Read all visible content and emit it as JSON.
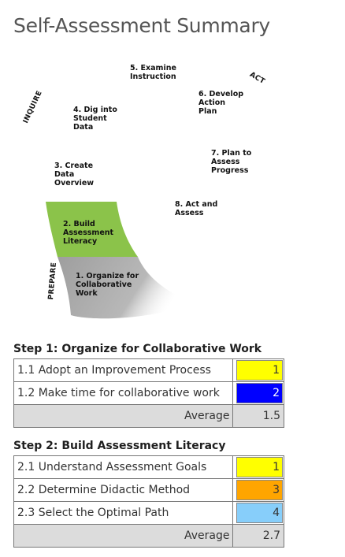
{
  "page": {
    "title": "Self-Assessment Summary"
  },
  "diagram": {
    "phases": {
      "inquire": "INQUIRE",
      "act": "ACT",
      "prepare": "PREPARE"
    },
    "steps": [
      {
        "label": "1. Organize for\nCollaborative\nWork"
      },
      {
        "label": "2. Build\nAssessment\nLiteracy"
      },
      {
        "label": "3. Create\nData\nOverview"
      },
      {
        "label": "4. Dig into\nStudent\nData"
      },
      {
        "label": "5. Examine\nInstruction"
      },
      {
        "label": "6. Develop\nAction\nPlan"
      },
      {
        "label": "7. Plan to\nAssess\nProgress"
      },
      {
        "label": "8. Act and\nAssess"
      }
    ],
    "colors": {
      "step2": "#8bc34a",
      "step1": "#b0b0b0"
    }
  },
  "sections": [
    {
      "heading": "Step 1: Organize for Collaborative Work",
      "rows": [
        {
          "label": "1.1 Adopt an Improvement Process",
          "value": "1",
          "color": "#ffff00",
          "text_color": "#333333"
        },
        {
          "label": "1.2 Make time for collaborative work",
          "value": "2",
          "color": "#0000ff",
          "text_color": "#ffffff"
        }
      ],
      "average_label": "Average",
      "average": "1.5"
    },
    {
      "heading": "Step 2: Build Assessment Literacy",
      "rows": [
        {
          "label": "2.1 Understand Assessment Goals",
          "value": "1",
          "color": "#ffff00",
          "text_color": "#333333"
        },
        {
          "label": "2.2 Determine Didactic Method",
          "value": "3",
          "color": "#ffa500",
          "text_color": "#333333"
        },
        {
          "label": "2.3 Select the Optimal Path",
          "value": "4",
          "color": "#87cefa",
          "text_color": "#333333"
        }
      ],
      "average_label": "Average",
      "average": "2.7"
    }
  ]
}
